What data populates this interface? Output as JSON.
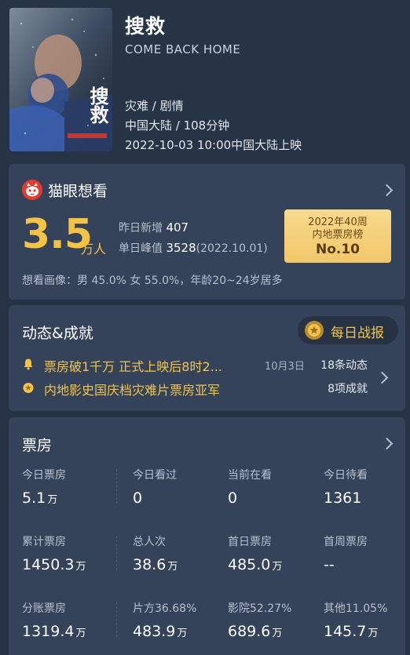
{
  "movie": {
    "title": "搜救",
    "english_title": "COME BACK HOME",
    "genres": "灾难 / 剧情",
    "region_duration": "中国大陆 / 108分钟",
    "release": "2022-10-03 10:00中国大陆上映",
    "poster_text": "搜救"
  },
  "maoyan": {
    "label": "猫眼想看",
    "count": "3.5",
    "count_unit": "万人",
    "yesterday_label": "昨日新增",
    "yesterday_value": "407",
    "peak_label": "单日峰值",
    "peak_value": "3528",
    "peak_date": "(2022.10.01)",
    "rank_line1": "2022年40周",
    "rank_line2": "内地票房榜",
    "rank_line3": "No.10",
    "portrait": "想看画像：男 45.0%  女 55.0%，年龄20~24岁居多"
  },
  "achievements": {
    "title": "动态&成就",
    "report_button": "每日战报",
    "items": [
      {
        "text": "票房破1千万 正式上映后8时2...",
        "date": "10月3日",
        "count": "18条动态"
      },
      {
        "text": "内地影史国庆档灾难片票房亚军",
        "date": "",
        "count": "8项成就"
      }
    ]
  },
  "boxoffice": {
    "title": "票房",
    "rows": [
      [
        {
          "label": "今日票房",
          "value": "5.1",
          "unit": "万"
        },
        {
          "label": "今日看过",
          "value": "0",
          "unit": ""
        },
        {
          "label": "当前在看",
          "value": "0",
          "unit": ""
        },
        {
          "label": "今日待看",
          "value": "1361",
          "unit": ""
        }
      ],
      [
        {
          "label": "累计票房",
          "value": "1450.3",
          "unit": "万"
        },
        {
          "label": "总人次",
          "value": "38.6",
          "unit": "万"
        },
        {
          "label": "首日票房",
          "value": "485.0",
          "unit": "万"
        },
        {
          "label": "首周票房",
          "value": "--",
          "unit": ""
        }
      ],
      [
        {
          "label": "分账票房",
          "value": "1319.4",
          "unit": "万"
        },
        {
          "label": "片方36.68%",
          "value": "483.9",
          "unit": "万"
        },
        {
          "label": "影院52.27%",
          "value": "689.6",
          "unit": "万"
        },
        {
          "label": "其他11.05%",
          "value": "145.7",
          "unit": "万"
        }
      ]
    ]
  },
  "colors": {
    "background": "#263445",
    "card": "#34435a",
    "accent_gold": "#f5c243",
    "maoyan_red": "#e63a2e"
  }
}
